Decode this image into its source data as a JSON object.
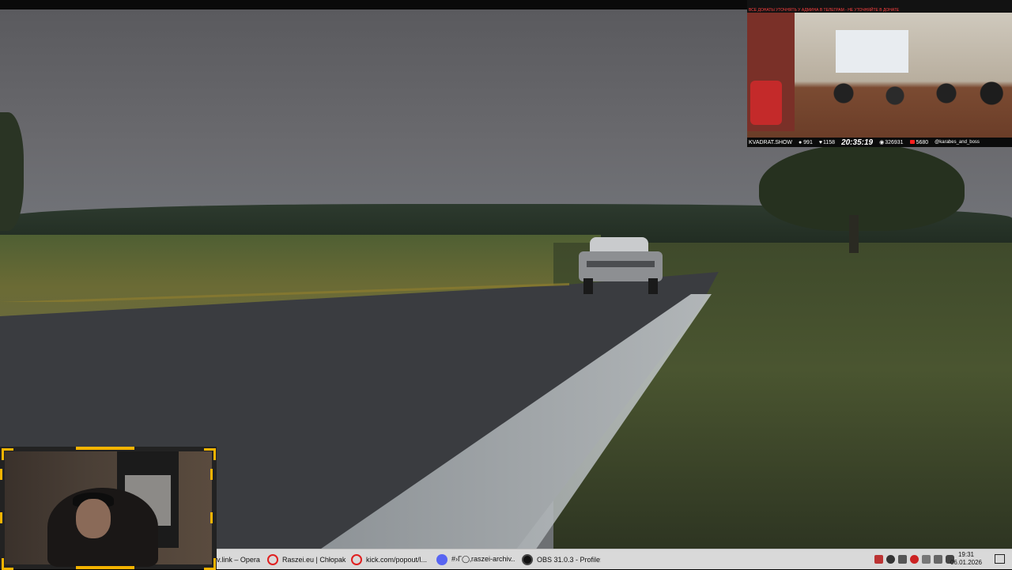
{
  "stream_overlay": {
    "banner_text": "ВСЕ ДОНАТЫ УТОЧНЯТЬ У АДМИНА В ТЕЛЕГРАМ - НЕ УТОЧНЯЙТЕ В ДОНАТЕ",
    "channel": "KVADRAT.SHOW",
    "viewers": "991",
    "likes": "1158",
    "time": "20:35:19",
    "watch_count": "326931",
    "live_count": "5680",
    "handle": "@karabes_and_boss"
  },
  "taskbar": {
    "tasks": [
      {
        "label": "v.link – Opera",
        "icon": "opera-icon"
      },
      {
        "label": "Raszei.eu | Chłopak...",
        "icon": "opera-icon"
      },
      {
        "label": "kick.com/popout/l...",
        "icon": "opera-icon"
      },
      {
        "label": "#›Γ◯‚raszei-archiv...",
        "icon": "discord-icon"
      },
      {
        "label": "OBS 31.0.3 - Profile:...",
        "icon": "obs-icon"
      }
    ],
    "tray_icons": [
      "network-icon",
      "g-hub-icon",
      "shield-icon",
      "media-icon",
      "volume-icon",
      "display-icon",
      "microphone-icon"
    ],
    "clock_time": "19:31",
    "clock_date": "06.01.2026"
  }
}
